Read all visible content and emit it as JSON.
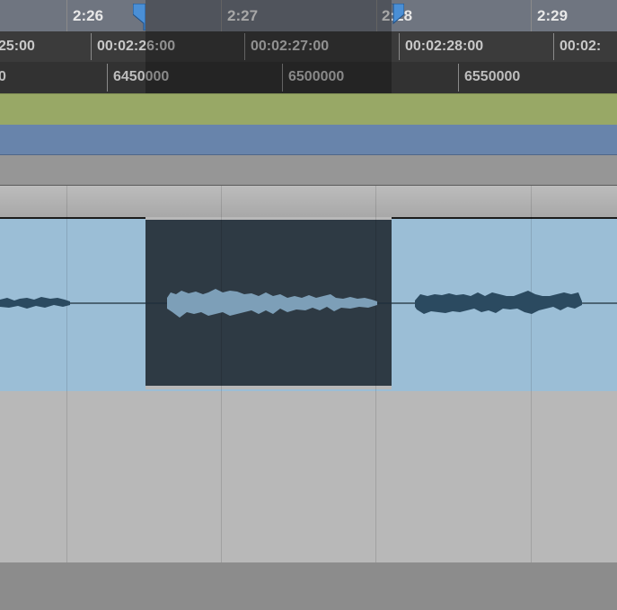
{
  "timeline": {
    "bars_beats": [
      {
        "label": "2:26"
      },
      {
        "label": "2:27"
      },
      {
        "label": "2:28"
      },
      {
        "label": "2:29"
      }
    ],
    "timecode": [
      {
        "label": "25:00"
      },
      {
        "label": "00:02:26:00"
      },
      {
        "label": "00:02:27:00"
      },
      {
        "label": "00:02:28:00"
      },
      {
        "label": "00:02:"
      }
    ],
    "samples": [
      {
        "label": "0"
      },
      {
        "label": "6450000"
      },
      {
        "label": "6500000"
      },
      {
        "label": "6550000"
      }
    ]
  },
  "colors": {
    "selection_marker": "#4a8fd6",
    "lane_green": "#98a866",
    "lane_blue": "#6884ab",
    "clip_fill": "#9bbed6",
    "clip_selected": "#2e3a44",
    "waveform": "#2b4a60",
    "waveform_selected": "#7d9fb8"
  },
  "icons": {
    "selection_start": "flag-down-icon",
    "selection_end": "flag-down-icon"
  }
}
